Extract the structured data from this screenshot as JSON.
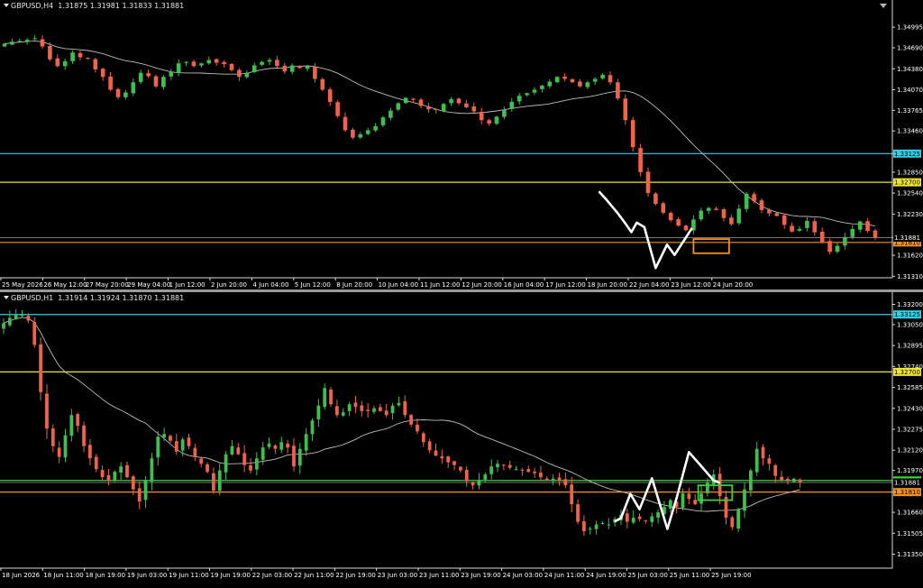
{
  "colors": {
    "background": "#000000",
    "axis": "#d9d9d9",
    "bull": "#3fbf4f",
    "bear": "#f0624a",
    "ma": "#bdbdbd",
    "price_line": "#9e9e9e",
    "cyan": "#2fd0e6",
    "yellow": "#f0e62e",
    "orange": "#f5901e",
    "green": "#39d23a",
    "pattern": "#ffffff"
  },
  "chart_data": [
    {
      "type": "candlestick",
      "title": "GBPUSD,H4",
      "ohlc_text": "1.31875 1.31981 1.31833 1.31881",
      "x_ticks": [
        "25 May 2026",
        "26 May 12:00",
        "27 May 20:00",
        "29 May 04:00",
        "1 Jun 12:00",
        "2 Jun 20:00",
        "4 Jun 04:00",
        "5 Jun 12:00",
        "8 Jun 20:00",
        "10 Jun 04:00",
        "11 Jun 12:00",
        "12 Jun 20:00",
        "16 Jun 04:00",
        "17 Jun 12:00",
        "18 Jun 20:00",
        "22 Jun 04:00",
        "23 Jun 12:00",
        "24 Jun 20:00"
      ],
      "y_ticks": [
        1.34995,
        1.3469,
        1.3438,
        1.3407,
        1.33765,
        1.3346,
        1.33125,
        1.3285,
        1.3254,
        1.3223,
        1.31881,
        1.3162,
        1.3131
      ],
      "ylim": [
        1.3131,
        1.3512
      ],
      "levels": [
        {
          "price": 1.33125,
          "label": "1.33125",
          "color": "cyan"
        },
        {
          "price": 1.327,
          "label": "1.32700",
          "color": "yellow"
        },
        {
          "price": 1.3181,
          "label": "1.31810",
          "color": "orange"
        }
      ],
      "last_price": {
        "price": 1.31881,
        "label": "1.31881"
      },
      "close_path": [
        1.3475,
        1.3478,
        1.3479,
        1.3481,
        1.3483,
        1.3471,
        1.3452,
        1.3442,
        1.3449,
        1.3462,
        1.3455,
        1.3453,
        1.3437,
        1.3426,
        1.3407,
        1.3396,
        1.3403,
        1.3418,
        1.3432,
        1.3427,
        1.3412,
        1.3426,
        1.3433,
        1.3446,
        1.3448,
        1.3442,
        1.3446,
        1.3451,
        1.3447,
        1.3445,
        1.3436,
        1.3426,
        1.3432,
        1.3443,
        1.3448,
        1.3451,
        1.3442,
        1.3434,
        1.3443,
        1.3439,
        1.3442,
        1.3423,
        1.3407,
        1.3389,
        1.3368,
        1.3347,
        1.3336,
        1.3341,
        1.3347,
        1.3353,
        1.3366,
        1.3376,
        1.3387,
        1.3395,
        1.3392,
        1.3383,
        1.3378,
        1.3377,
        1.3386,
        1.3393,
        1.3387,
        1.3381,
        1.3375,
        1.3362,
        1.3357,
        1.3367,
        1.3377,
        1.3389,
        1.3398,
        1.3402,
        1.3407,
        1.3413,
        1.3419,
        1.3426,
        1.3423,
        1.3418,
        1.3412,
        1.3418,
        1.3423,
        1.3429,
        1.3418,
        1.3394,
        1.3362,
        1.3322,
        1.3285,
        1.3254,
        1.3238,
        1.3225,
        1.3214,
        1.3206,
        1.3199,
        1.3215,
        1.3228,
        1.3232,
        1.3229,
        1.3217,
        1.3208,
        1.3231,
        1.3253,
        1.3242,
        1.3229,
        1.3224,
        1.322,
        1.3207,
        1.3197,
        1.3201,
        1.3213,
        1.3196,
        1.3182,
        1.3167,
        1.3176,
        1.3189,
        1.3201,
        1.3212,
        1.3198,
        1.3188
      ],
      "ma_period": 18,
      "pattern_path": [
        [
          78.5,
          1.32566
        ],
        [
          79.5,
          1.32443
        ],
        [
          81,
          1.32242
        ],
        [
          82,
          1.32091
        ],
        [
          82.8,
          1.31963
        ],
        [
          83.5,
          1.32103
        ],
        [
          84.5,
          1.32038
        ],
        [
          86,
          1.31432
        ],
        [
          87.5,
          1.31777
        ],
        [
          88.5,
          1.31625
        ],
        [
          89.5,
          1.31799
        ],
        [
          90.8,
          1.32021
        ]
      ],
      "target_box": [
        [
          91,
          1.3186
        ],
        [
          95.7,
          1.3165
        ]
      ]
    },
    {
      "type": "candlestick",
      "title": "GBPUSD,H1",
      "ohlc_text": "1.31914 1.31924 1.31870 1.31881",
      "x_ticks": [
        "18 Jun 2026",
        "18 Jun 11:00",
        "18 Jun 19:00",
        "19 Jun 03:00",
        "19 Jun 11:00",
        "19 Jun 19:00",
        "22 Jun 03:00",
        "22 Jun 11:00",
        "22 Jun 19:00",
        "23 Jun 03:00",
        "23 Jun 11:00",
        "23 Jun 19:00",
        "24 Jun 03:00",
        "24 Jun 11:00",
        "24 Jun 19:00",
        "25 Jun 03:00",
        "25 Jun 11:00",
        "25 Jun 19:00"
      ],
      "y_ticks": [
        1.332,
        1.3305,
        1.32895,
        1.3274,
        1.32585,
        1.3243,
        1.32275,
        1.3212,
        1.3197,
        1.3181,
        1.3166,
        1.31505,
        1.3135
      ],
      "ylim": [
        1.3128,
        1.3327
      ],
      "levels": [
        {
          "price": 1.33125,
          "label": "1.33125",
          "color": "cyan"
        },
        {
          "price": 1.327,
          "label": "1.32700",
          "color": "yellow"
        },
        {
          "price": 1.31896,
          "label": "1.31896",
          "color": "green"
        },
        {
          "price": 1.3181,
          "label": "1.31810",
          "color": "orange"
        }
      ],
      "last_price": {
        "price": 1.31881,
        "label": "1.31881"
      },
      "close_path": [
        1.3306,
        1.331,
        1.3312,
        1.3313,
        1.3308,
        1.329,
        1.3255,
        1.3228,
        1.3215,
        1.3207,
        1.3223,
        1.3238,
        1.323,
        1.3215,
        1.3206,
        1.3198,
        1.3192,
        1.319,
        1.3196,
        1.32,
        1.3192,
        1.3183,
        1.3174,
        1.319,
        1.3206,
        1.3222,
        1.3224,
        1.3219,
        1.3211,
        1.322,
        1.3215,
        1.3207,
        1.3202,
        1.3196,
        1.3182,
        1.3197,
        1.3209,
        1.3215,
        1.3209,
        1.3201,
        1.3197,
        1.3206,
        1.3214,
        1.3217,
        1.3213,
        1.3218,
        1.3214,
        1.32,
        1.3213,
        1.3224,
        1.3234,
        1.3245,
        1.3258,
        1.3246,
        1.3238,
        1.324,
        1.3246,
        1.3244,
        1.3241,
        1.3241,
        1.3243,
        1.3241,
        1.3238,
        1.3245,
        1.3247,
        1.3238,
        1.3231,
        1.3226,
        1.3218,
        1.3212,
        1.3208,
        1.3206,
        1.3203,
        1.3201,
        1.3197,
        1.3189,
        1.3186,
        1.319,
        1.3194,
        1.32,
        1.3202,
        1.3201,
        1.3199,
        1.3198,
        1.3197,
        1.3196,
        1.3195,
        1.3192,
        1.319,
        1.3191,
        1.319,
        1.3186,
        1.3172,
        1.3159,
        1.3152,
        1.3154,
        1.3157,
        1.3158,
        1.3157,
        1.3161,
        1.3164,
        1.3159,
        1.3162,
        1.3161,
        1.316,
        1.3163,
        1.3166,
        1.317,
        1.3175,
        1.317,
        1.318,
        1.3176,
        1.3172,
        1.318,
        1.3188,
        1.3194,
        1.3178,
        1.3162,
        1.3155,
        1.3168,
        1.3183,
        1.3197,
        1.3213,
        1.3206,
        1.3202,
        1.3193,
        1.319,
        1.3189,
        1.3191,
        1.3188
      ],
      "ma_period": 24,
      "pattern_path": [
        [
          99,
          1.31592
        ],
        [
          100,
          1.31618
        ],
        [
          101.5,
          1.31797
        ],
        [
          103,
          1.31683
        ],
        [
          105,
          1.31912
        ],
        [
          107.5,
          1.31537
        ],
        [
          109,
          1.31765
        ],
        [
          111,
          1.32106
        ],
        [
          113,
          1.32002
        ],
        [
          115,
          1.31896
        ],
        [
          116,
          1.31878
        ]
      ],
      "target_box": [
        [
          112.5,
          1.3186
        ],
        [
          118,
          1.3175
        ]
      ]
    }
  ]
}
